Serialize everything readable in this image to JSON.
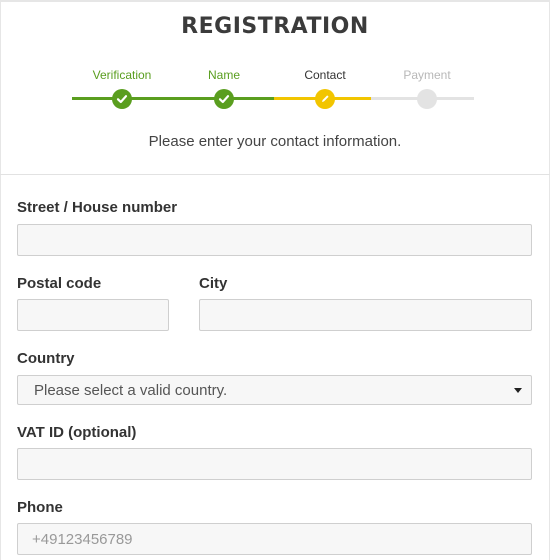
{
  "header": {
    "title": "REGISTRATION",
    "subtitle": "Please enter your contact information."
  },
  "stepper": {
    "steps": [
      {
        "label": "Verification",
        "state": "completed"
      },
      {
        "label": "Name",
        "state": "completed"
      },
      {
        "label": "Contact",
        "state": "current"
      },
      {
        "label": "Payment",
        "state": "upcoming"
      }
    ],
    "colors": {
      "completed": "#5a9e1f",
      "current": "#f2c500",
      "upcoming": "#e3e3e3",
      "upcoming_label": "#b8b8b8"
    }
  },
  "form": {
    "street_label": "Street / House number",
    "street_value": "",
    "postal_label": "Postal code",
    "postal_value": "",
    "city_label": "City",
    "city_value": "",
    "country_label": "Country",
    "country_selected": "Please select a valid country.",
    "vat_label": "VAT ID (optional)",
    "vat_value": "",
    "phone_label": "Phone",
    "phone_placeholder": "+49123456789",
    "phone_value": ""
  }
}
